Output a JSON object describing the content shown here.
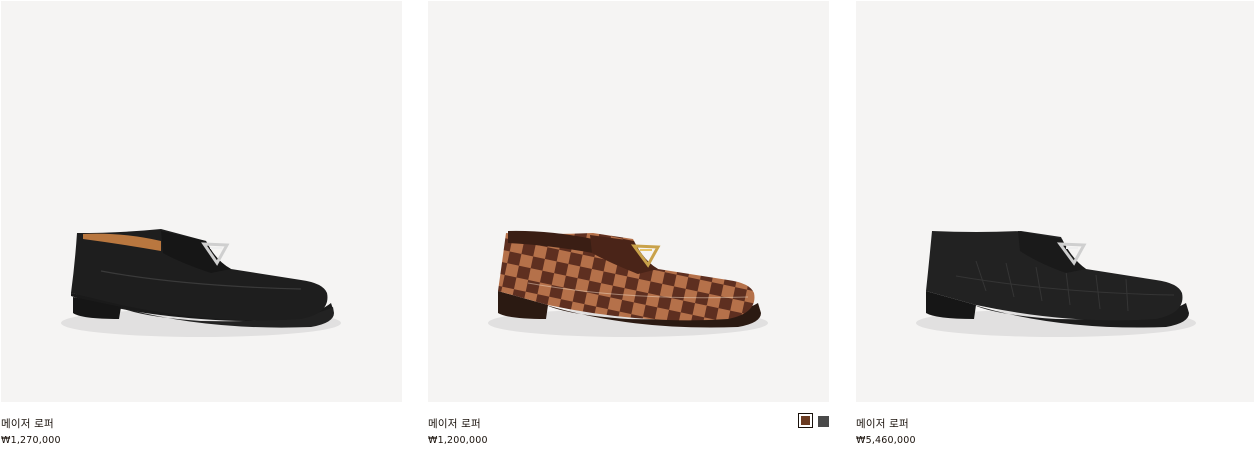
{
  "products": [
    {
      "name": "메이저 로퍼",
      "price": "₩1,270,000",
      "image_icon": "loafer-black-epi-icon"
    },
    {
      "name": "메이저 로퍼",
      "price": "₩1,200,000",
      "image_icon": "loafer-damier-ebene-icon",
      "swatches": [
        {
          "color": "#6b3b22",
          "selected": true
        },
        {
          "color": "#4a4a4a",
          "selected": false
        }
      ]
    },
    {
      "name": "메이저 로퍼",
      "price": "₩5,460,000",
      "image_icon": "loafer-black-croc-icon"
    }
  ],
  "colors": {
    "image_background": "#f5f4f3",
    "text": "#19110b"
  }
}
